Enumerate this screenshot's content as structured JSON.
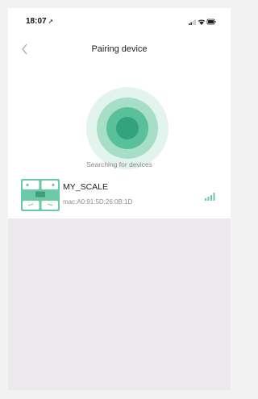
{
  "status_bar": {
    "time": "18:07",
    "location_arrow": "➚",
    "icons": [
      "cellular-signal-icon",
      "wifi-icon",
      "battery-icon"
    ]
  },
  "nav": {
    "back_icon": "chevron-left-icon",
    "title": "Pairing device"
  },
  "search": {
    "status_text": "Searching for devices"
  },
  "devices": [
    {
      "name": "MY_SCALE",
      "mac": "mac:A0:91:5D:26:0B:1D",
      "icon": "scale-icon",
      "signal_icon": "signal-strength-icon"
    }
  ],
  "colors": {
    "accent": "#4fbf98",
    "accent_dark": "#2e9c77",
    "ring_light": "#d9f1e8",
    "ring_mid": "#9ad9bf",
    "background_lower": "#ece8ec"
  }
}
